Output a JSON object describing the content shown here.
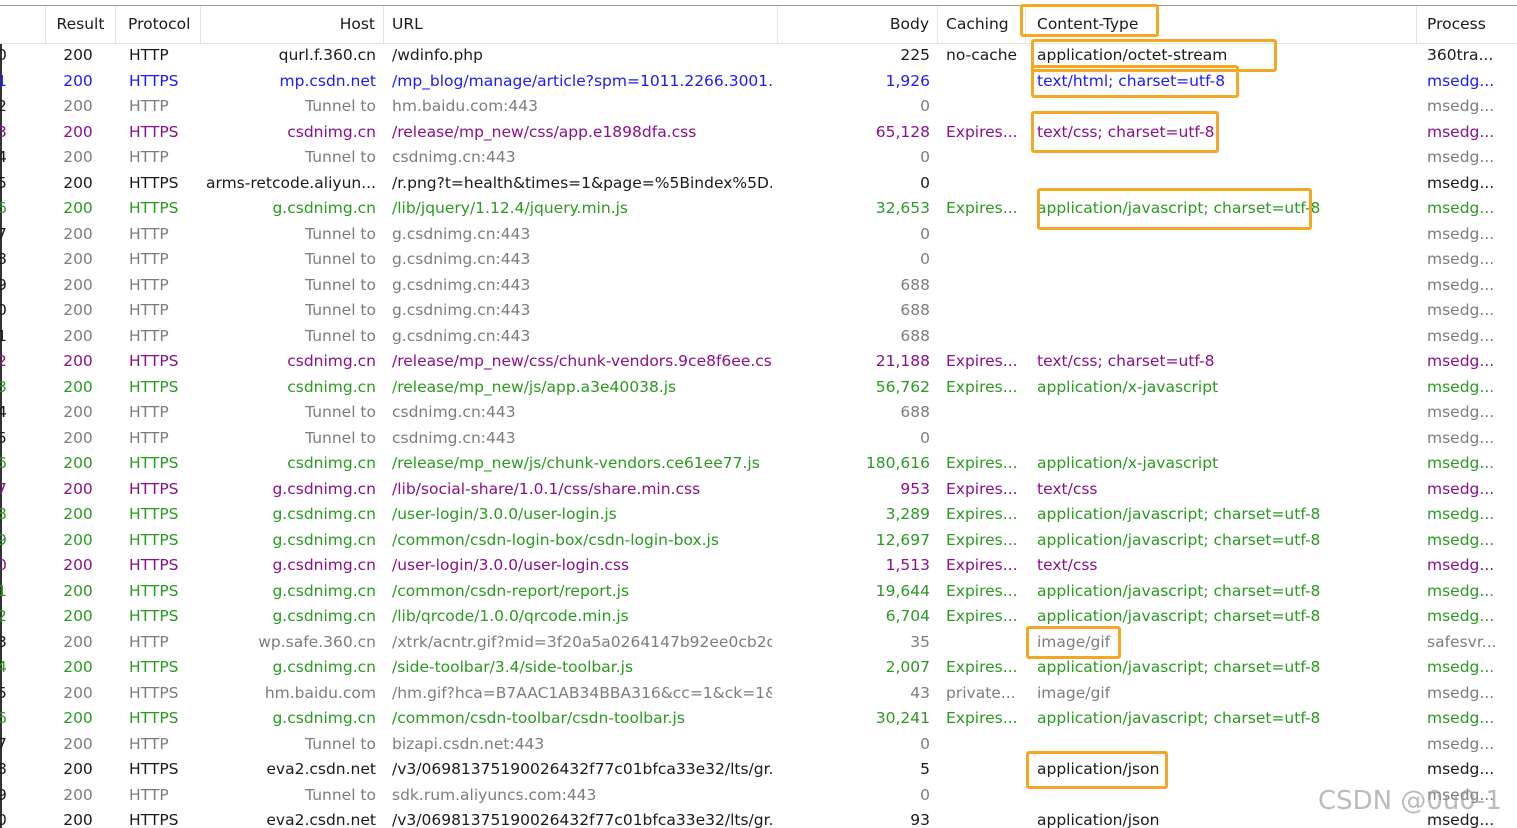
{
  "columns": {
    "result": "Result",
    "protocol": "Protocol",
    "host": "Host",
    "url": "URL",
    "body": "Body",
    "caching": "Caching",
    "content_type": "Content-Type",
    "process": "Process"
  },
  "colors": {
    "black": "#1a1a1a",
    "blue": "#1a1aff",
    "gray": "#7d7d7d",
    "purple": "#8b0f8b",
    "green": "#2a9a20",
    "highlight": "#f5a623"
  },
  "rows": [
    {
      "num": "0",
      "result": "200",
      "protocol": "HTTP",
      "host": "qurl.f.360.cn",
      "url": "/wdinfo.php",
      "body": "225",
      "caching": "no-cache",
      "content_type": "application/octet-stream",
      "process": "360tra...",
      "color": "black"
    },
    {
      "num": "1",
      "result": "200",
      "protocol": "HTTPS",
      "host": "mp.csdn.net",
      "url": "/mp_blog/manage/article?spm=1011.2266.3001....",
      "body": "1,926",
      "caching": "",
      "content_type": "text/html; charset=utf-8",
      "process": "msedg...",
      "color": "blue"
    },
    {
      "num": "2",
      "result": "200",
      "protocol": "HTTP",
      "host": "Tunnel to",
      "url": "hm.baidu.com:443",
      "body": "0",
      "caching": "",
      "content_type": "",
      "process": "msedg...",
      "color": "gray"
    },
    {
      "num": "3",
      "result": "200",
      "protocol": "HTTPS",
      "host": "csdnimg.cn",
      "url": "/release/mp_new/css/app.e1898dfa.css",
      "body": "65,128",
      "caching": "Expires...",
      "content_type": "text/css; charset=utf-8",
      "process": "msedg...",
      "color": "purple"
    },
    {
      "num": "4",
      "result": "200",
      "protocol": "HTTP",
      "host": "Tunnel to",
      "url": "csdnimg.cn:443",
      "body": "0",
      "caching": "",
      "content_type": "",
      "process": "msedg...",
      "color": "gray"
    },
    {
      "num": "5",
      "result": "200",
      "protocol": "HTTPS",
      "host": "arms-retcode.aliyun...",
      "url": "/r.png?t=health&times=1&page=%5Bindex%5D...",
      "body": "0",
      "caching": "",
      "content_type": "",
      "process": "msedg...",
      "color": "black"
    },
    {
      "num": "6",
      "result": "200",
      "protocol": "HTTPS",
      "host": "g.csdnimg.cn",
      "url": "/lib/jquery/1.12.4/jquery.min.js",
      "body": "32,653",
      "caching": "Expires...",
      "content_type": "application/javascript; charset=utf-8",
      "process": "msedg...",
      "color": "green"
    },
    {
      "num": "7",
      "result": "200",
      "protocol": "HTTP",
      "host": "Tunnel to",
      "url": "g.csdnimg.cn:443",
      "body": "0",
      "caching": "",
      "content_type": "",
      "process": "msedg...",
      "color": "gray"
    },
    {
      "num": "8",
      "result": "200",
      "protocol": "HTTP",
      "host": "Tunnel to",
      "url": "g.csdnimg.cn:443",
      "body": "0",
      "caching": "",
      "content_type": "",
      "process": "msedg...",
      "color": "gray"
    },
    {
      "num": "9",
      "result": "200",
      "protocol": "HTTP",
      "host": "Tunnel to",
      "url": "g.csdnimg.cn:443",
      "body": "688",
      "caching": "",
      "content_type": "",
      "process": "msedg...",
      "color": "gray"
    },
    {
      "num": "0",
      "result": "200",
      "protocol": "HTTP",
      "host": "Tunnel to",
      "url": "g.csdnimg.cn:443",
      "body": "688",
      "caching": "",
      "content_type": "",
      "process": "msedg...",
      "color": "gray"
    },
    {
      "num": "1",
      "result": "200",
      "protocol": "HTTP",
      "host": "Tunnel to",
      "url": "g.csdnimg.cn:443",
      "body": "688",
      "caching": "",
      "content_type": "",
      "process": "msedg...",
      "color": "gray"
    },
    {
      "num": "2",
      "result": "200",
      "protocol": "HTTPS",
      "host": "csdnimg.cn",
      "url": "/release/mp_new/css/chunk-vendors.9ce8f6ee.css",
      "body": "21,188",
      "caching": "Expires...",
      "content_type": "text/css; charset=utf-8",
      "process": "msedg...",
      "color": "purple"
    },
    {
      "num": "3",
      "result": "200",
      "protocol": "HTTPS",
      "host": "csdnimg.cn",
      "url": "/release/mp_new/js/app.a3e40038.js",
      "body": "56,762",
      "caching": "Expires...",
      "content_type": "application/x-javascript",
      "process": "msedg...",
      "color": "green"
    },
    {
      "num": "4",
      "result": "200",
      "protocol": "HTTP",
      "host": "Tunnel to",
      "url": "csdnimg.cn:443",
      "body": "688",
      "caching": "",
      "content_type": "",
      "process": "msedg...",
      "color": "gray"
    },
    {
      "num": "5",
      "result": "200",
      "protocol": "HTTP",
      "host": "Tunnel to",
      "url": "csdnimg.cn:443",
      "body": "0",
      "caching": "",
      "content_type": "",
      "process": "msedg...",
      "color": "gray"
    },
    {
      "num": "6",
      "result": "200",
      "protocol": "HTTPS",
      "host": "csdnimg.cn",
      "url": "/release/mp_new/js/chunk-vendors.ce61ee77.js",
      "body": "180,616",
      "caching": "Expires...",
      "content_type": "application/x-javascript",
      "process": "msedg...",
      "color": "green"
    },
    {
      "num": "7",
      "result": "200",
      "protocol": "HTTPS",
      "host": "g.csdnimg.cn",
      "url": "/lib/social-share/1.0.1/css/share.min.css",
      "body": "953",
      "caching": "Expires...",
      "content_type": "text/css",
      "process": "msedg...",
      "color": "purple"
    },
    {
      "num": "8",
      "result": "200",
      "protocol": "HTTPS",
      "host": "g.csdnimg.cn",
      "url": "/user-login/3.0.0/user-login.js",
      "body": "3,289",
      "caching": "Expires...",
      "content_type": "application/javascript; charset=utf-8",
      "process": "msedg...",
      "color": "green"
    },
    {
      "num": "9",
      "result": "200",
      "protocol": "HTTPS",
      "host": "g.csdnimg.cn",
      "url": "/common/csdn-login-box/csdn-login-box.js",
      "body": "12,697",
      "caching": "Expires...",
      "content_type": "application/javascript; charset=utf-8",
      "process": "msedg...",
      "color": "green"
    },
    {
      "num": "0",
      "result": "200",
      "protocol": "HTTPS",
      "host": "g.csdnimg.cn",
      "url": "/user-login/3.0.0/user-login.css",
      "body": "1,513",
      "caching": "Expires...",
      "content_type": "text/css",
      "process": "msedg...",
      "color": "purple"
    },
    {
      "num": "1",
      "result": "200",
      "protocol": "HTTPS",
      "host": "g.csdnimg.cn",
      "url": "/common/csdn-report/report.js",
      "body": "19,644",
      "caching": "Expires...",
      "content_type": "application/javascript; charset=utf-8",
      "process": "msedg...",
      "color": "green"
    },
    {
      "num": "2",
      "result": "200",
      "protocol": "HTTPS",
      "host": "g.csdnimg.cn",
      "url": "/lib/qrcode/1.0.0/qrcode.min.js",
      "body": "6,704",
      "caching": "Expires...",
      "content_type": "application/javascript; charset=utf-8",
      "process": "msedg...",
      "color": "green"
    },
    {
      "num": "3",
      "result": "200",
      "protocol": "HTTP",
      "host": "wp.safe.360.cn",
      "url": "/xtrk/acntr.gif?mid=3f20a5a0264147b92ee0cb2d...",
      "body": "35",
      "caching": "",
      "content_type": "image/gif",
      "process": "safesvr...",
      "color": "gray"
    },
    {
      "num": "4",
      "result": "200",
      "protocol": "HTTPS",
      "host": "g.csdnimg.cn",
      "url": "/side-toolbar/3.4/side-toolbar.js",
      "body": "2,007",
      "caching": "Expires...",
      "content_type": "application/javascript; charset=utf-8",
      "process": "msedg...",
      "color": "green"
    },
    {
      "num": "5",
      "result": "200",
      "protocol": "HTTPS",
      "host": "hm.baidu.com",
      "url": "/hm.gif?hca=B7AAC1AB34BBA316&cc=1&ck=1&c...",
      "body": "43",
      "caching": "private...",
      "content_type": "image/gif",
      "process": "msedg...",
      "color": "gray"
    },
    {
      "num": "6",
      "result": "200",
      "protocol": "HTTPS",
      "host": "g.csdnimg.cn",
      "url": "/common/csdn-toolbar/csdn-toolbar.js",
      "body": "30,241",
      "caching": "Expires...",
      "content_type": "application/javascript; charset=utf-8",
      "process": "msedg...",
      "color": "green"
    },
    {
      "num": "7",
      "result": "200",
      "protocol": "HTTP",
      "host": "Tunnel to",
      "url": "bizapi.csdn.net:443",
      "body": "0",
      "caching": "",
      "content_type": "",
      "process": "msedg...",
      "color": "gray"
    },
    {
      "num": "8",
      "result": "200",
      "protocol": "HTTPS",
      "host": "eva2.csdn.net",
      "url": "/v3/06981375190026432f77c01bfca33e32/lts/gr...",
      "body": "5",
      "caching": "",
      "content_type": "application/json",
      "process": "msedg...",
      "color": "black"
    },
    {
      "num": "9",
      "result": "200",
      "protocol": "HTTP",
      "host": "Tunnel to",
      "url": "sdk.rum.aliyuncs.com:443",
      "body": "0",
      "caching": "",
      "content_type": "",
      "process": "msedg...",
      "color": "gray"
    },
    {
      "num": "0",
      "result": "200",
      "protocol": "HTTPS",
      "host": "eva2.csdn.net",
      "url": "/v3/06981375190026432f77c01bfca33e32/lts/gr...",
      "body": "93",
      "caching": "",
      "content_type": "application/json",
      "process": "msedg...",
      "color": "black"
    }
  ],
  "highlighted_rows": [
    0,
    1,
    3,
    6,
    23,
    28
  ],
  "watermark": "CSDN @0u0-1"
}
